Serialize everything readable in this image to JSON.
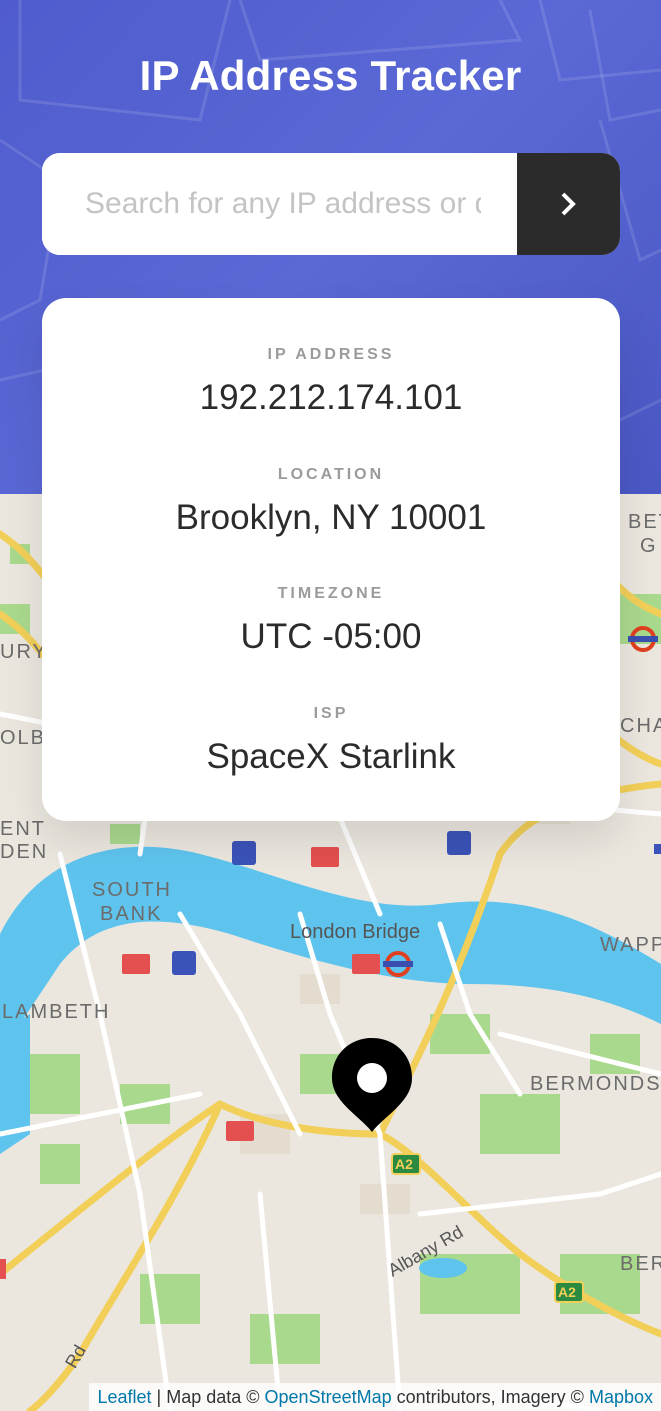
{
  "app": {
    "title": "IP Address Tracker"
  },
  "search": {
    "placeholder": "Search for any IP address or domain",
    "value": "",
    "submit_icon": "chevron-right-icon"
  },
  "info": {
    "ip": {
      "label": "IP ADDRESS",
      "value": "192.212.174.101"
    },
    "location": {
      "label": "LOCATION",
      "value": "Brooklyn, NY 10001"
    },
    "timezone": {
      "label": "TIMEZONE",
      "value": "UTC -05:00"
    },
    "isp": {
      "label": "ISP",
      "value": "SpaceX Starlink"
    }
  },
  "map": {
    "labels": {
      "south": "SOUTH",
      "bank": "BANK",
      "london_bridge": "London Bridge",
      "lambeth": "LAMBETH",
      "bermondsey": "BERMONDSE",
      "wapping": "WAPP",
      "albany_rd": "Albany Rd",
      "a2": "A2",
      "a2_b": "A2",
      "bury": "URY",
      "olbo": "OLBO",
      "ent": "ENT",
      "den": "DEN",
      "bet": "BET",
      "cha": "CHA",
      "ber": "BER",
      "g": "G",
      "rd": "Rd"
    },
    "marker_icon": "location-pin-icon"
  },
  "attribution": {
    "leaflet": "Leaflet",
    "sep": " | Map data © ",
    "osm": "OpenStreetMap",
    "mid": " contributors, Imagery © ",
    "mapbox": "Mapbox"
  },
  "colors": {
    "header": "#5161d0",
    "button": "#2b2b2b",
    "water": "#5ec4ee",
    "road": "#f2cf58",
    "park": "#a8d98b"
  }
}
